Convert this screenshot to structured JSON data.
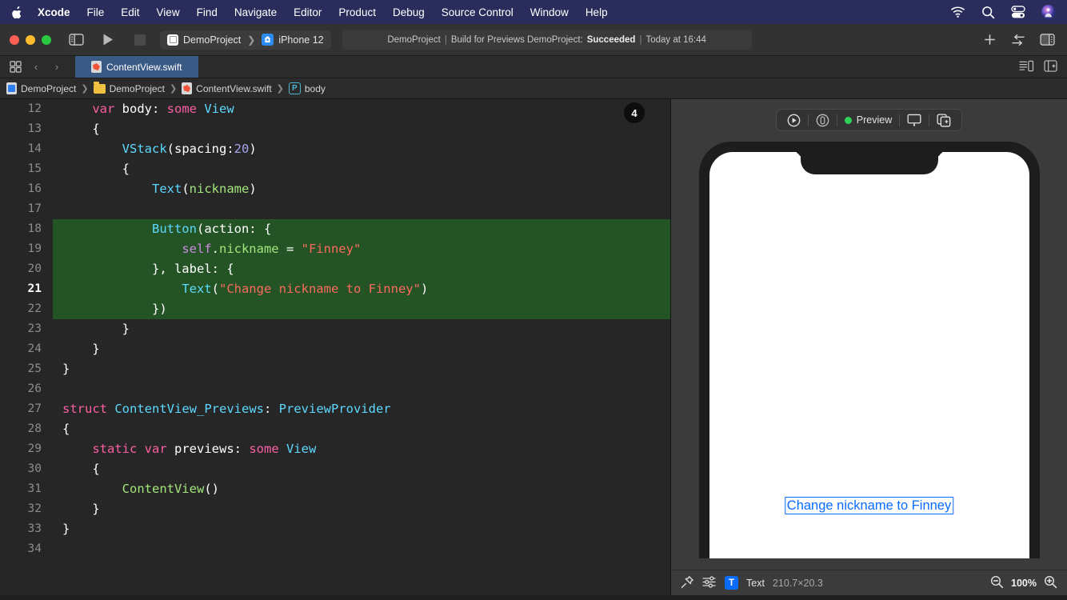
{
  "menubar": {
    "apple_icon": "apple-logo-icon",
    "items": [
      {
        "label": "Xcode",
        "bold": true
      },
      {
        "label": "File",
        "bold": false
      },
      {
        "label": "Edit",
        "bold": false
      },
      {
        "label": "View",
        "bold": false
      },
      {
        "label": "Find",
        "bold": false
      },
      {
        "label": "Navigate",
        "bold": false
      },
      {
        "label": "Editor",
        "bold": false
      },
      {
        "label": "Product",
        "bold": false
      },
      {
        "label": "Debug",
        "bold": false
      },
      {
        "label": "Source Control",
        "bold": false
      },
      {
        "label": "Window",
        "bold": false
      },
      {
        "label": "Help",
        "bold": false
      }
    ],
    "status_icons": [
      "wifi-icon",
      "search-icon",
      "control-center-icon",
      "user-avatar-icon"
    ],
    "background": "#2a2d5c"
  },
  "toolbar": {
    "window_controls": [
      "close-button",
      "minimize-button",
      "zoom-button"
    ],
    "sidebar_toggle_icon": "sidebar-toggle-icon",
    "run_icon": "run-button",
    "stop_icon": "stop-button",
    "scheme": {
      "app_name": "DemoProject",
      "separator": "❯",
      "device_name": "iPhone 12"
    },
    "status": {
      "project": "DemoProject",
      "sep": "|",
      "action": "Build for Previews DemoProject:",
      "result": "Succeeded",
      "time": "Today at 16:44"
    },
    "add_label": "+",
    "right_icons": [
      "add-button",
      "swap-editor-icon",
      "inspector-toggle-icon"
    ]
  },
  "tabbar": {
    "grid_icon": "tab-grid-icon",
    "back_label": "‹",
    "forward_label": "›",
    "active_tab": "ContentView.swift",
    "right_icons": [
      "minimap-toggle-icon",
      "add-editor-icon"
    ]
  },
  "breadcrumb": {
    "items": [
      {
        "icon": "project-icon",
        "label": "DemoProject"
      },
      {
        "icon": "folder-icon",
        "label": "DemoProject"
      },
      {
        "icon": "swift-file-icon",
        "label": "ContentView.swift"
      },
      {
        "icon": "property-badge-icon",
        "label": "body",
        "badge": "P"
      }
    ],
    "separator": "❯"
  },
  "editor": {
    "highlight_badge": "4",
    "current_line": 21,
    "highlight_color": "#245425",
    "lines": [
      {
        "n": 12,
        "tokens": [
          {
            "t": "    ",
            "c": "pl"
          },
          {
            "t": "var",
            "c": "kw"
          },
          {
            "t": " body",
            "c": "pl"
          },
          {
            "t": ":",
            "c": "pl"
          },
          {
            "t": " some",
            "c": "kw"
          },
          {
            "t": " ",
            "c": "pl"
          },
          {
            "t": "View",
            "c": "ty"
          }
        ],
        "hl": false
      },
      {
        "n": 13,
        "tokens": [
          {
            "t": "    {",
            "c": "pl"
          }
        ],
        "hl": false
      },
      {
        "n": 14,
        "tokens": [
          {
            "t": "        ",
            "c": "pl"
          },
          {
            "t": "VStack",
            "c": "ty"
          },
          {
            "t": "(spacing:",
            "c": "pl"
          },
          {
            "t": "20",
            "c": "num"
          },
          {
            "t": ")",
            "c": "pl"
          }
        ],
        "hl": false
      },
      {
        "n": 15,
        "tokens": [
          {
            "t": "        {",
            "c": "pl"
          }
        ],
        "hl": false
      },
      {
        "n": 16,
        "tokens": [
          {
            "t": "            ",
            "c": "pl"
          },
          {
            "t": "Text",
            "c": "ty"
          },
          {
            "t": "(",
            "c": "pl"
          },
          {
            "t": "nickname",
            "c": "var"
          },
          {
            "t": ")",
            "c": "pl"
          }
        ],
        "hl": false
      },
      {
        "n": 17,
        "tokens": [
          {
            "t": "",
            "c": "pl"
          }
        ],
        "hl": false
      },
      {
        "n": 18,
        "tokens": [
          {
            "t": "            ",
            "c": "pl"
          },
          {
            "t": "Button",
            "c": "ty"
          },
          {
            "t": "(action: {",
            "c": "pl"
          }
        ],
        "hl": true
      },
      {
        "n": 19,
        "tokens": [
          {
            "t": "                ",
            "c": "pl"
          },
          {
            "t": "self",
            "c": "slf"
          },
          {
            "t": ".",
            "c": "pl"
          },
          {
            "t": "nickname",
            "c": "var"
          },
          {
            "t": " = ",
            "c": "pl"
          },
          {
            "t": "\"Finney\"",
            "c": "str"
          }
        ],
        "hl": true
      },
      {
        "n": 20,
        "tokens": [
          {
            "t": "            }, label: {",
            "c": "pl"
          }
        ],
        "hl": true
      },
      {
        "n": 21,
        "tokens": [
          {
            "t": "                ",
            "c": "pl"
          },
          {
            "t": "Text",
            "c": "ty"
          },
          {
            "t": "(",
            "c": "pl"
          },
          {
            "t": "\"Change nickname to Finney\"",
            "c": "str"
          },
          {
            "t": ")",
            "c": "pl"
          }
        ],
        "hl": true
      },
      {
        "n": 22,
        "tokens": [
          {
            "t": "            })",
            "c": "pl"
          }
        ],
        "hl": true
      },
      {
        "n": 23,
        "tokens": [
          {
            "t": "        }",
            "c": "pl"
          }
        ],
        "hl": false
      },
      {
        "n": 24,
        "tokens": [
          {
            "t": "    }",
            "c": "pl"
          }
        ],
        "hl": false
      },
      {
        "n": 25,
        "tokens": [
          {
            "t": "}",
            "c": "pl"
          }
        ],
        "hl": false
      },
      {
        "n": 26,
        "tokens": [
          {
            "t": "",
            "c": "pl"
          }
        ],
        "hl": false
      },
      {
        "n": 27,
        "tokens": [
          {
            "t": "struct",
            "c": "kw"
          },
          {
            "t": " ",
            "c": "pl"
          },
          {
            "t": "ContentView_Previews",
            "c": "ty"
          },
          {
            "t": ": ",
            "c": "pl"
          },
          {
            "t": "PreviewProvider",
            "c": "ty"
          }
        ],
        "hl": false
      },
      {
        "n": 28,
        "tokens": [
          {
            "t": "{",
            "c": "pl"
          }
        ],
        "hl": false
      },
      {
        "n": 29,
        "tokens": [
          {
            "t": "    ",
            "c": "pl"
          },
          {
            "t": "static",
            "c": "kw"
          },
          {
            "t": " ",
            "c": "pl"
          },
          {
            "t": "var",
            "c": "kw"
          },
          {
            "t": " previews",
            "c": "pl"
          },
          {
            "t": ": ",
            "c": "pl"
          },
          {
            "t": "some",
            "c": "kw"
          },
          {
            "t": " ",
            "c": "pl"
          },
          {
            "t": "View",
            "c": "ty"
          }
        ],
        "hl": false
      },
      {
        "n": 30,
        "tokens": [
          {
            "t": "    {",
            "c": "pl"
          }
        ],
        "hl": false
      },
      {
        "n": 31,
        "tokens": [
          {
            "t": "        ",
            "c": "pl"
          },
          {
            "t": "ContentView",
            "c": "var"
          },
          {
            "t": "()",
            "c": "pl"
          }
        ],
        "hl": false
      },
      {
        "n": 32,
        "tokens": [
          {
            "t": "    }",
            "c": "pl"
          }
        ],
        "hl": false
      },
      {
        "n": 33,
        "tokens": [
          {
            "t": "}",
            "c": "pl"
          }
        ],
        "hl": false
      },
      {
        "n": 34,
        "tokens": [
          {
            "t": "",
            "c": "pl"
          }
        ],
        "hl": false
      }
    ]
  },
  "preview": {
    "toolbar": {
      "play_icon": "play-preview-icon",
      "inspect_icon": "inspect-preview-icon",
      "status_label": "Preview",
      "status_color": "#30d158",
      "device_icon": "preview-on-device-icon",
      "duplicate_icon": "duplicate-preview-icon"
    },
    "device_name": "iPhone 12",
    "canvas_label": "Change nickname to Finney",
    "label_color": "#0a6cff",
    "bottom": {
      "pin_icon": "pin-icon",
      "filter_icon": "filter-sliders-icon",
      "type_badge": "T",
      "type_label": "Text",
      "dimensions": "210.7×20.3",
      "zoom_out_icon": "zoom-out-icon",
      "zoom_level": "100%",
      "zoom_in_icon": "zoom-in-icon"
    }
  }
}
